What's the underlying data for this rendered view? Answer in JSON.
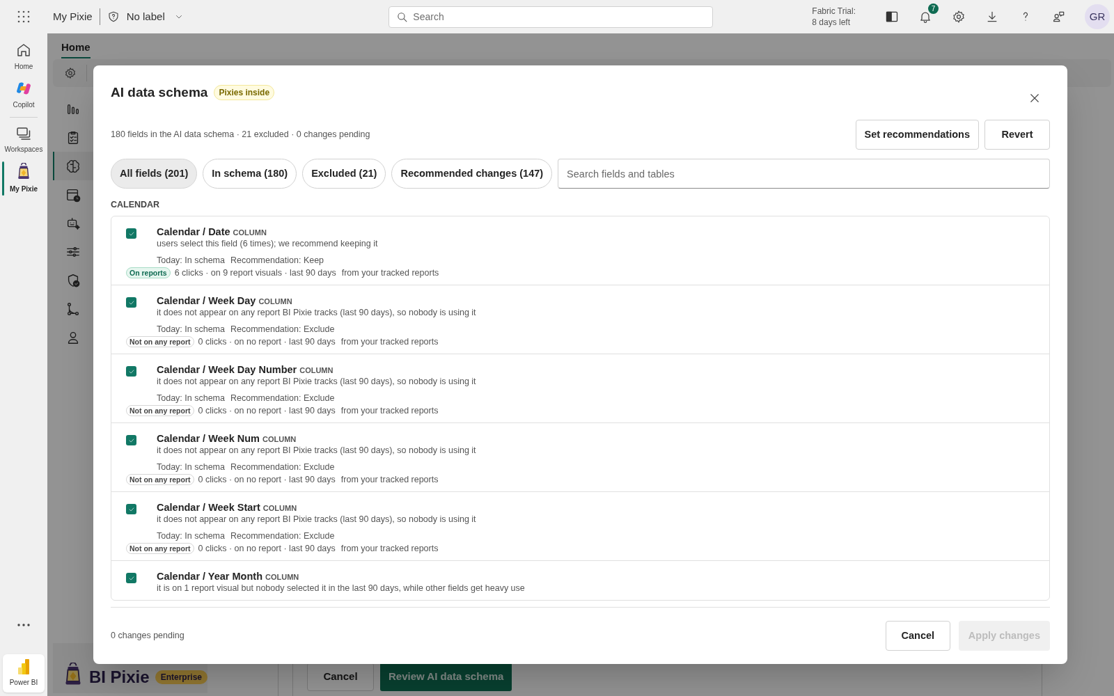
{
  "top_bar": {
    "app_name": "My Pixie",
    "sensitivity_label": "No label",
    "search": {
      "placeholder": "Search"
    },
    "trial_line_1": "Fabric Trial:",
    "trial_line_2": "8 days left",
    "notification_count": "7",
    "avatar": "GR"
  },
  "rail": [
    {
      "label": "Home",
      "selected": false
    },
    {
      "label": "Copilot",
      "selected": false
    },
    {
      "label": "Workspaces",
      "selected": false
    },
    {
      "label": "My Pixie",
      "selected": true
    }
  ],
  "rail_footer": "Power BI",
  "background": {
    "tabs": [
      {
        "label": "Home",
        "selected": true
      }
    ],
    "nav": [
      {
        "selected": false
      },
      {
        "selected": false
      },
      {
        "selected": true
      },
      {
        "selected": false
      },
      {
        "selected": false
      },
      {
        "selected": false
      },
      {
        "selected": false
      },
      {
        "selected": false
      },
      {
        "selected": false
      }
    ],
    "brand": "BI Pixie",
    "edition": "Enterprise",
    "buttons": [
      {
        "label": "Cancel",
        "kind": "secondary"
      },
      {
        "label": "Review AI data schema",
        "kind": "primary"
      }
    ]
  },
  "dialog": {
    "title": "AI data schema",
    "title_badge": "Pixies inside",
    "summary": "180 fields in the AI data schema · 21 excluded · 0 changes pending",
    "header_buttons": [
      "Set recommendations",
      "Revert"
    ],
    "filters": [
      {
        "label": "All fields (201)",
        "selected": true
      },
      {
        "label": "In schema (180)",
        "selected": false
      },
      {
        "label": "Excluded (21)",
        "selected": false
      },
      {
        "label": "Recommended changes (147)",
        "selected": false
      }
    ],
    "search": {
      "placeholder": "Search fields and tables"
    },
    "section": "CALENDAR",
    "fields": [
      {
        "name": "Calendar / Date",
        "type": "COLUMN",
        "checked": true,
        "reason": "users select this field (6 times); we recommend keeping it",
        "today": "Today: In schema",
        "recommendation": "Recommendation: Keep",
        "usage": {
          "kind": "on",
          "label": "On reports"
        },
        "stats": "6 clicks · on 9 report visuals · last 90 days",
        "source": "from your tracked reports"
      },
      {
        "name": "Calendar / Week Day",
        "type": "COLUMN",
        "checked": true,
        "reason": "it does not appear on any report BI Pixie tracks (last 90 days), so nobody is using it",
        "today": "Today: In schema",
        "recommendation": "Recommendation: Exclude",
        "usage": {
          "kind": "off",
          "label": "Not on any report"
        },
        "stats": "0 clicks · on no report · last 90 days",
        "source": "from your tracked reports"
      },
      {
        "name": "Calendar / Week Day Number",
        "type": "COLUMN",
        "checked": true,
        "reason": "it does not appear on any report BI Pixie tracks (last 90 days), so nobody is using it",
        "today": "Today: In schema",
        "recommendation": "Recommendation: Exclude",
        "usage": {
          "kind": "off",
          "label": "Not on any report"
        },
        "stats": "0 clicks · on no report · last 90 days",
        "source": "from your tracked reports"
      },
      {
        "name": "Calendar / Week Num",
        "type": "COLUMN",
        "checked": true,
        "reason": "it does not appear on any report BI Pixie tracks (last 90 days), so nobody is using it",
        "today": "Today: In schema",
        "recommendation": "Recommendation: Exclude",
        "usage": {
          "kind": "off",
          "label": "Not on any report"
        },
        "stats": "0 clicks · on no report · last 90 days",
        "source": "from your tracked reports"
      },
      {
        "name": "Calendar / Week Start",
        "type": "COLUMN",
        "checked": true,
        "reason": "it does not appear on any report BI Pixie tracks (last 90 days), so nobody is using it",
        "today": "Today: In schema",
        "recommendation": "Recommendation: Exclude",
        "usage": {
          "kind": "off",
          "label": "Not on any report"
        },
        "stats": "0 clicks · on no report · last 90 days",
        "source": "from your tracked reports"
      },
      {
        "name": "Calendar / Year Month",
        "type": "COLUMN",
        "checked": true,
        "reason": "it is on 1 report visual but nobody selected it in the last 90 days, while other fields get heavy use"
      }
    ],
    "footer_status": "0 changes pending",
    "footer_buttons": [
      {
        "label": "Cancel",
        "disabled": false
      },
      {
        "label": "Apply changes",
        "disabled": true
      }
    ]
  }
}
